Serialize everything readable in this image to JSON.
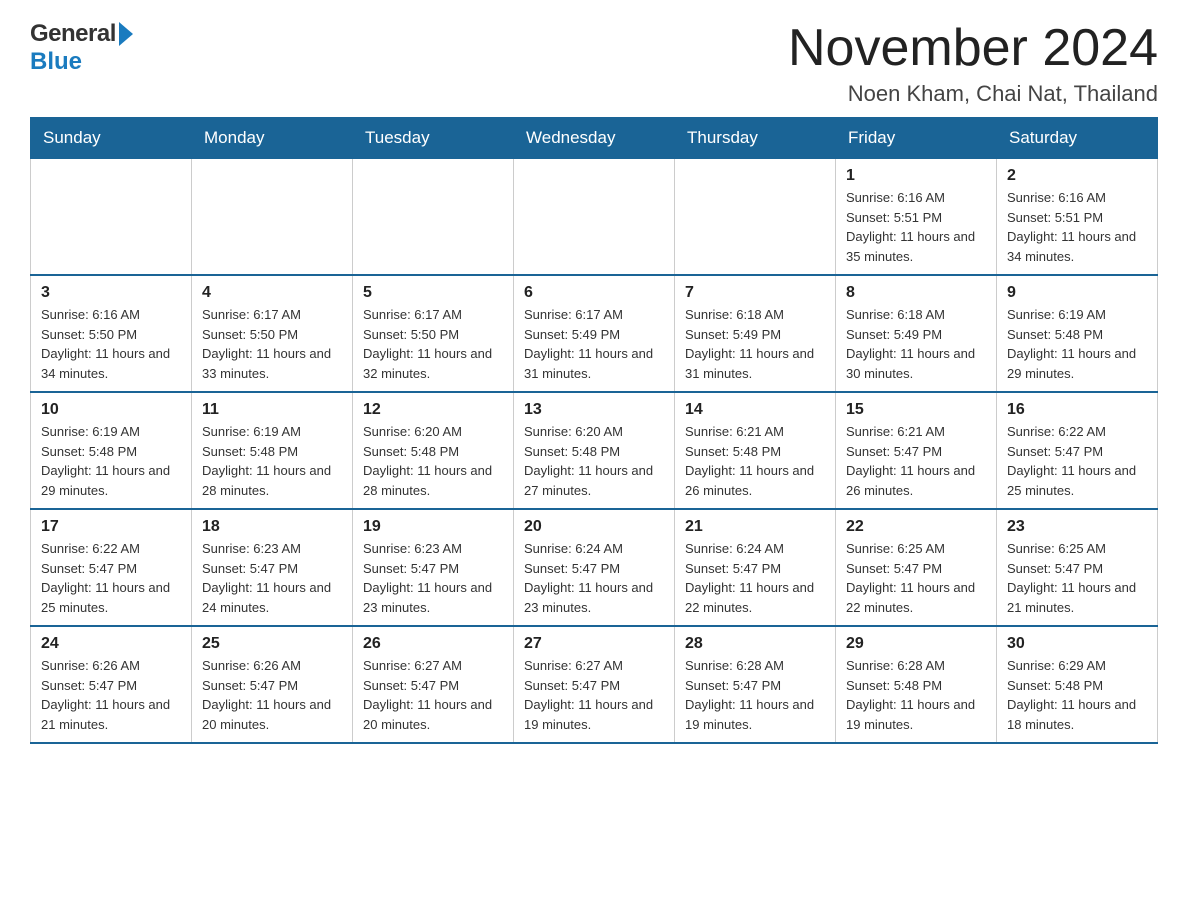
{
  "header": {
    "title": "November 2024",
    "subtitle": "Noen Kham, Chai Nat, Thailand",
    "logo_general": "General",
    "logo_blue": "Blue"
  },
  "days_of_week": [
    "Sunday",
    "Monday",
    "Tuesday",
    "Wednesday",
    "Thursday",
    "Friday",
    "Saturday"
  ],
  "weeks": [
    [
      {
        "day": "",
        "info": ""
      },
      {
        "day": "",
        "info": ""
      },
      {
        "day": "",
        "info": ""
      },
      {
        "day": "",
        "info": ""
      },
      {
        "day": "",
        "info": ""
      },
      {
        "day": "1",
        "info": "Sunrise: 6:16 AM\nSunset: 5:51 PM\nDaylight: 11 hours and 35 minutes."
      },
      {
        "day": "2",
        "info": "Sunrise: 6:16 AM\nSunset: 5:51 PM\nDaylight: 11 hours and 34 minutes."
      }
    ],
    [
      {
        "day": "3",
        "info": "Sunrise: 6:16 AM\nSunset: 5:50 PM\nDaylight: 11 hours and 34 minutes."
      },
      {
        "day": "4",
        "info": "Sunrise: 6:17 AM\nSunset: 5:50 PM\nDaylight: 11 hours and 33 minutes."
      },
      {
        "day": "5",
        "info": "Sunrise: 6:17 AM\nSunset: 5:50 PM\nDaylight: 11 hours and 32 minutes."
      },
      {
        "day": "6",
        "info": "Sunrise: 6:17 AM\nSunset: 5:49 PM\nDaylight: 11 hours and 31 minutes."
      },
      {
        "day": "7",
        "info": "Sunrise: 6:18 AM\nSunset: 5:49 PM\nDaylight: 11 hours and 31 minutes."
      },
      {
        "day": "8",
        "info": "Sunrise: 6:18 AM\nSunset: 5:49 PM\nDaylight: 11 hours and 30 minutes."
      },
      {
        "day": "9",
        "info": "Sunrise: 6:19 AM\nSunset: 5:48 PM\nDaylight: 11 hours and 29 minutes."
      }
    ],
    [
      {
        "day": "10",
        "info": "Sunrise: 6:19 AM\nSunset: 5:48 PM\nDaylight: 11 hours and 29 minutes."
      },
      {
        "day": "11",
        "info": "Sunrise: 6:19 AM\nSunset: 5:48 PM\nDaylight: 11 hours and 28 minutes."
      },
      {
        "day": "12",
        "info": "Sunrise: 6:20 AM\nSunset: 5:48 PM\nDaylight: 11 hours and 28 minutes."
      },
      {
        "day": "13",
        "info": "Sunrise: 6:20 AM\nSunset: 5:48 PM\nDaylight: 11 hours and 27 minutes."
      },
      {
        "day": "14",
        "info": "Sunrise: 6:21 AM\nSunset: 5:48 PM\nDaylight: 11 hours and 26 minutes."
      },
      {
        "day": "15",
        "info": "Sunrise: 6:21 AM\nSunset: 5:47 PM\nDaylight: 11 hours and 26 minutes."
      },
      {
        "day": "16",
        "info": "Sunrise: 6:22 AM\nSunset: 5:47 PM\nDaylight: 11 hours and 25 minutes."
      }
    ],
    [
      {
        "day": "17",
        "info": "Sunrise: 6:22 AM\nSunset: 5:47 PM\nDaylight: 11 hours and 25 minutes."
      },
      {
        "day": "18",
        "info": "Sunrise: 6:23 AM\nSunset: 5:47 PM\nDaylight: 11 hours and 24 minutes."
      },
      {
        "day": "19",
        "info": "Sunrise: 6:23 AM\nSunset: 5:47 PM\nDaylight: 11 hours and 23 minutes."
      },
      {
        "day": "20",
        "info": "Sunrise: 6:24 AM\nSunset: 5:47 PM\nDaylight: 11 hours and 23 minutes."
      },
      {
        "day": "21",
        "info": "Sunrise: 6:24 AM\nSunset: 5:47 PM\nDaylight: 11 hours and 22 minutes."
      },
      {
        "day": "22",
        "info": "Sunrise: 6:25 AM\nSunset: 5:47 PM\nDaylight: 11 hours and 22 minutes."
      },
      {
        "day": "23",
        "info": "Sunrise: 6:25 AM\nSunset: 5:47 PM\nDaylight: 11 hours and 21 minutes."
      }
    ],
    [
      {
        "day": "24",
        "info": "Sunrise: 6:26 AM\nSunset: 5:47 PM\nDaylight: 11 hours and 21 minutes."
      },
      {
        "day": "25",
        "info": "Sunrise: 6:26 AM\nSunset: 5:47 PM\nDaylight: 11 hours and 20 minutes."
      },
      {
        "day": "26",
        "info": "Sunrise: 6:27 AM\nSunset: 5:47 PM\nDaylight: 11 hours and 20 minutes."
      },
      {
        "day": "27",
        "info": "Sunrise: 6:27 AM\nSunset: 5:47 PM\nDaylight: 11 hours and 19 minutes."
      },
      {
        "day": "28",
        "info": "Sunrise: 6:28 AM\nSunset: 5:47 PM\nDaylight: 11 hours and 19 minutes."
      },
      {
        "day": "29",
        "info": "Sunrise: 6:28 AM\nSunset: 5:48 PM\nDaylight: 11 hours and 19 minutes."
      },
      {
        "day": "30",
        "info": "Sunrise: 6:29 AM\nSunset: 5:48 PM\nDaylight: 11 hours and 18 minutes."
      }
    ]
  ]
}
